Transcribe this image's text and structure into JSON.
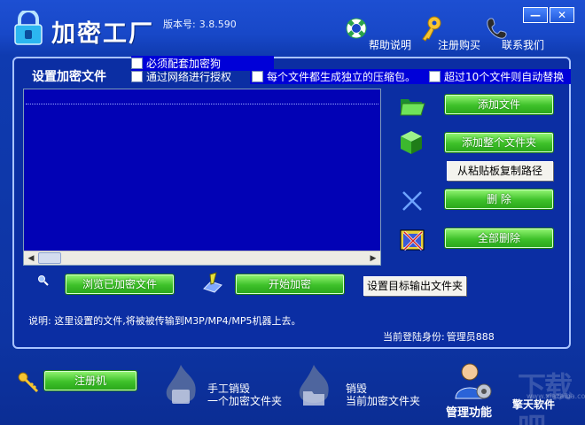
{
  "header": {
    "app_title": "加密工厂",
    "version_label": "版本号:",
    "version_value": "3.8.590",
    "help": {
      "label": "帮助说明",
      "icon": "lifebuoy-icon"
    },
    "register": {
      "label": "注册购买",
      "icon": "key-icon"
    },
    "contact": {
      "label": "联系我们",
      "icon": "phone-icon"
    },
    "window_buttons": {
      "minimize": "—",
      "close": "✕"
    }
  },
  "panel": {
    "title": "设置加密文件",
    "options": [
      {
        "label": "必须配套加密狗",
        "checked": false
      },
      {
        "label": "通过网络进行授权",
        "checked": false
      },
      {
        "label": "每个文件都生成独立的压缩包。",
        "checked": false
      },
      {
        "label": "超过10个文件则自动替换",
        "checked": false
      }
    ],
    "file_list": {
      "items": []
    },
    "buttons": {
      "add_file": "添加文件",
      "add_folder": "添加整个文件夹",
      "copy_clipboard": "从粘贴板复制路径",
      "delete": "删  除",
      "delete_all": "全部删除",
      "browse_encrypted": "浏览已加密文件",
      "start_encrypt": "开始加密",
      "set_output": "设置目标输出文件夹"
    },
    "description": "说明: 这里设置的文件,将被被传输到M3P/MP4/MP5机器上去。",
    "login_label": "当前登陆身份:",
    "login_user": "管理员888"
  },
  "footer": {
    "keygen": "注册机",
    "manual_destroy_line1": "手工销毁",
    "manual_destroy_line2": "一个加密文件夹",
    "destroy_line1": "销毁",
    "destroy_line2": "当前加密文件夹",
    "manage": "管理功能",
    "brand": "擎天软件",
    "watermark": "下载吧",
    "watermark_sub": "www.xiazaiba.com"
  },
  "colors": {
    "background": "#0f3bb0",
    "list_background": "#0202b5",
    "green_button": "#3ec12a",
    "highlight": "#0000d8"
  }
}
